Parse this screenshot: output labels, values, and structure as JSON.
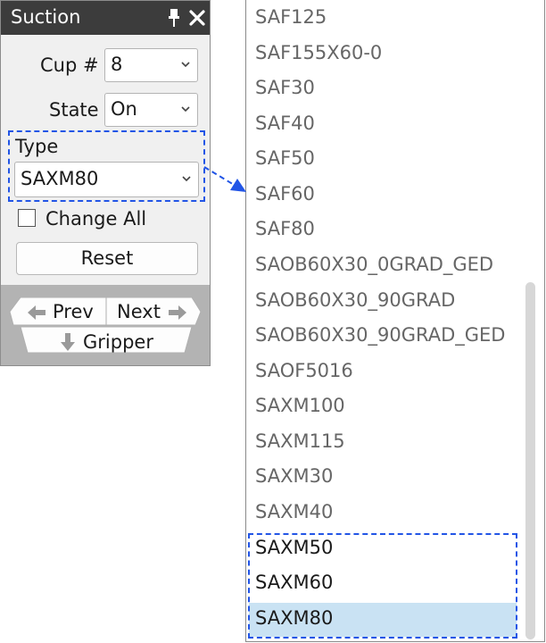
{
  "panel": {
    "title": "Suction",
    "cup_label": "Cup #",
    "cup_value": "8",
    "state_label": "State",
    "state_value": "On",
    "type_label": "Type",
    "type_value": "SAXM80",
    "change_all_label": "Change All",
    "reset_label": "Reset",
    "prev_label": "Prev",
    "next_label": "Next",
    "gripper_label": "Gripper"
  },
  "dropdown": {
    "items": [
      "SAF125",
      "SAF155X60-0",
      "SAF30",
      "SAF40",
      "SAF50",
      "SAF60",
      "SAF80",
      "SAOB60X30_0GRAD_GED",
      "SAOB60X30_90GRAD",
      "SAOB60X30_90GRAD_GED",
      "SAOF5016",
      "SAXM100",
      "SAXM115",
      "SAXM30",
      "SAXM40",
      "SAXM50",
      "SAXM60",
      "SAXM80"
    ],
    "selected": "SAXM80"
  },
  "colors": {
    "titlebar": "#3c3c3c",
    "highlight_dash": "#2255e6",
    "selection_bg": "#c9e2f3"
  }
}
